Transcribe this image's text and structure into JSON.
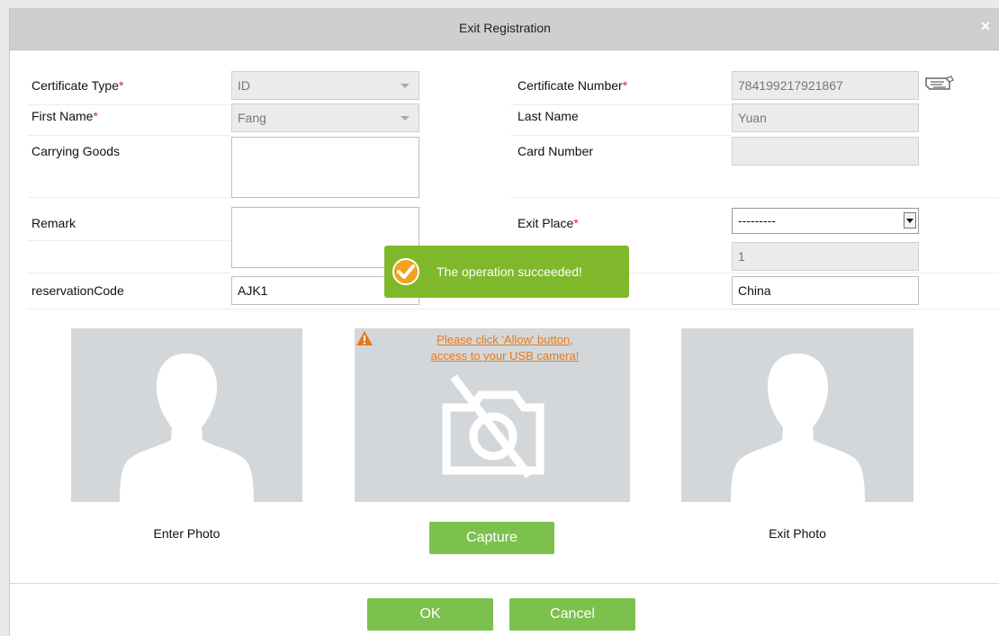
{
  "dialog": {
    "title": "Exit Registration",
    "close": "×"
  },
  "form": {
    "certificate_type": {
      "label": "Certificate Type",
      "required": "*",
      "value": "ID"
    },
    "certificate_number": {
      "label": "Certificate Number",
      "required": "*",
      "value": "784199217921867"
    },
    "first_name": {
      "label": "First Name",
      "required": "*",
      "value": "Fang"
    },
    "last_name": {
      "label": "Last Name",
      "value": "Yuan"
    },
    "carrying_goods": {
      "label": "Carrying Goods",
      "value": ""
    },
    "card_number": {
      "label": "Card Number",
      "value": ""
    },
    "remark": {
      "label": "Remark",
      "value": ""
    },
    "exit_place": {
      "label": "Exit Place",
      "required": "*",
      "value": "---------"
    },
    "hidden_count": {
      "value": "1"
    },
    "reservation_code": {
      "label": "reservationCode",
      "value": "AJK1"
    },
    "country": {
      "value": "China"
    }
  },
  "photos": {
    "enter_caption": "Enter Photo",
    "exit_caption": "Exit Photo",
    "camera_warning_line1": "Please click 'Allow' button,",
    "camera_warning_line2": "access to your USB camera!",
    "capture_label": "Capture"
  },
  "toast": {
    "message": "The operation succeeded!"
  },
  "footer": {
    "ok_label": "OK",
    "cancel_label": "Cancel"
  },
  "colors": {
    "accent": "#7cc14e",
    "toast": "#80b82b",
    "required": "#e0281e",
    "warning": "#e37b20"
  }
}
